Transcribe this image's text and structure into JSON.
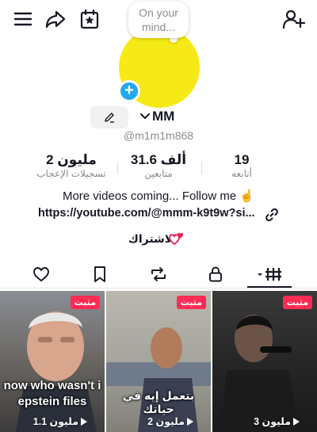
{
  "header": {
    "icons": [
      "menu-icon",
      "share-icon",
      "calendar-star-icon",
      "add-user-icon"
    ]
  },
  "profile": {
    "note_line1": "On your",
    "note_line2": "mind...",
    "display_name": "MM",
    "username": "@m1m1m868",
    "avatar_color": "#f5ea15",
    "add_badge_color": "#20a8f0"
  },
  "stats": {
    "likes_value": "2 مليون",
    "likes_label": "تسجيلات الإعجاب",
    "followers_value": "31.6 ألف",
    "followers_label": "متابعين",
    "following_value": "19",
    "following_label": "أتابعه"
  },
  "bio": {
    "text": "More videos coming... Follow me ☝️",
    "link": "https://youtube.com/@mmm-k9t9w?si...",
    "subscribe_label": "الاشتراك"
  },
  "tabs": [
    "liked-heart-icon",
    "bookmark-icon",
    "repost-icon",
    "lock-icon",
    "grid-icon"
  ],
  "videos": [
    {
      "badge": "مثبت",
      "caption": "now who wasn't i epstein files",
      "views": "1.1 مليون"
    },
    {
      "badge": "مثبت",
      "caption": "بتعمل إيه في حياتك",
      "views": "2 مليون"
    },
    {
      "badge": "مثبت",
      "caption": "",
      "views": "3 مليون"
    }
  ],
  "colors": {
    "badge": "#fe2c55",
    "text_primary": "#161823",
    "text_secondary": "#8a8b91"
  }
}
